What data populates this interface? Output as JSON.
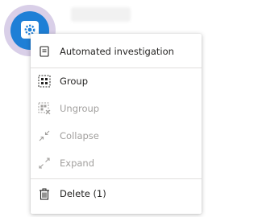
{
  "menu": {
    "items": [
      {
        "label": "Automated investigation",
        "icon": "document-icon",
        "enabled": true
      },
      {
        "label": "Group",
        "icon": "group-icon",
        "enabled": true
      },
      {
        "label": "Ungroup",
        "icon": "ungroup-icon",
        "enabled": false
      },
      {
        "label": "Collapse",
        "icon": "collapse-icon",
        "enabled": false
      },
      {
        "label": "Expand",
        "icon": "expand-icon",
        "enabled": false
      },
      {
        "label": "Delete (1)",
        "icon": "trash-icon",
        "enabled": true
      }
    ]
  },
  "node": {
    "icon": "gear-icon"
  },
  "colors": {
    "node_fill": "#1e7fd6",
    "node_halo": "#d9cfe8",
    "text": "#252423",
    "text_disabled": "#a19f9d",
    "separator": "#e1dfdd"
  }
}
